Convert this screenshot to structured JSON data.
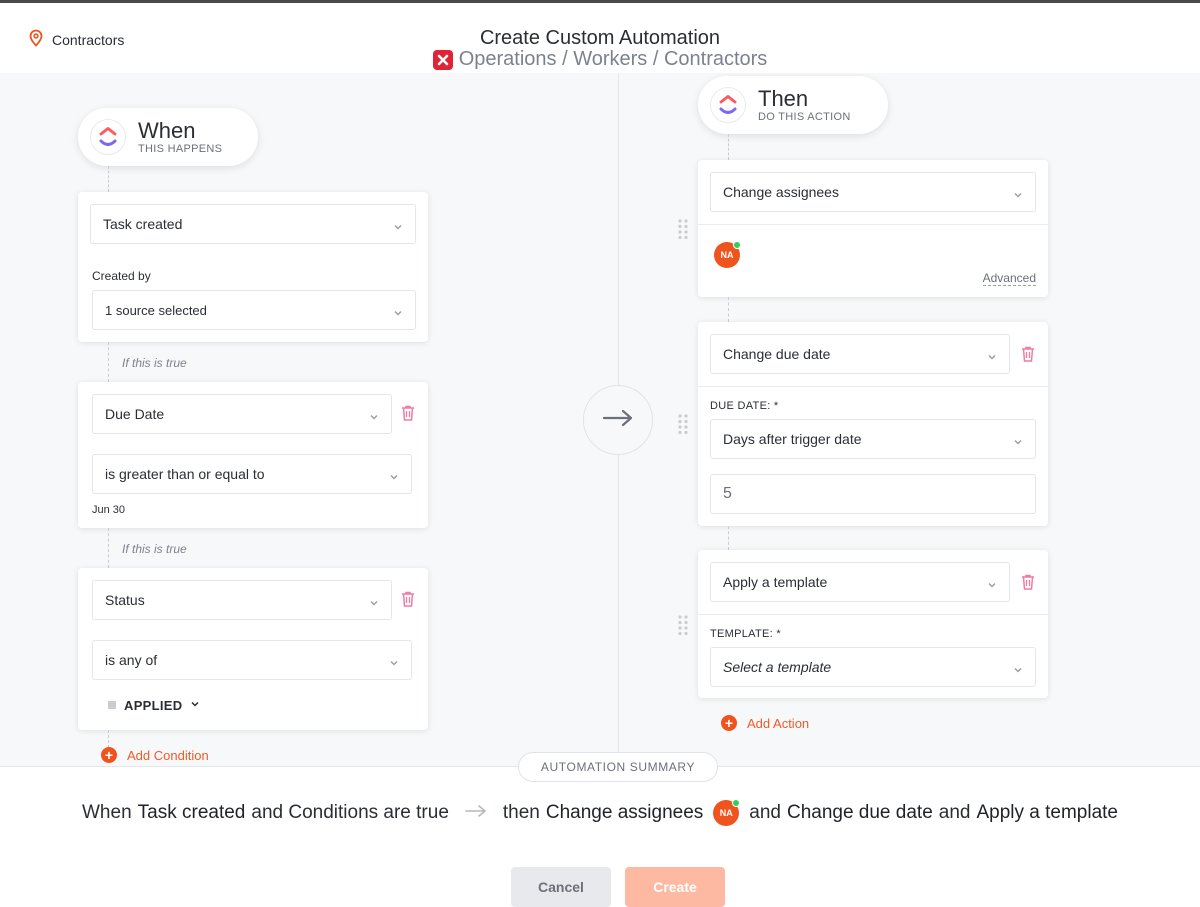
{
  "header": {
    "location_label": "Contractors",
    "title": "Create Custom Automation",
    "path": "Operations / Workers / Contractors"
  },
  "when": {
    "title": "When",
    "subtitle": "THIS HAPPENS",
    "trigger": {
      "select": "Task created",
      "created_by_label": "Created by",
      "source_select": "1 source selected"
    },
    "conditions": [
      {
        "connector": "If this is true",
        "field": "Due Date",
        "operator": "is greater than or equal to",
        "value": "Jun 30"
      },
      {
        "connector": "If this is true",
        "field": "Status",
        "operator": "is any of",
        "value": "APPLIED"
      }
    ],
    "add_condition": "Add Condition"
  },
  "then": {
    "title": "Then",
    "subtitle": "DO THIS ACTION",
    "actions": [
      {
        "select": "Change assignees",
        "assignee_initials": "NA",
        "advanced": "Advanced"
      },
      {
        "select": "Change due date",
        "field_label": "DUE DATE: *",
        "mode": "Days after trigger date",
        "days_value": "5"
      },
      {
        "select": "Apply a template",
        "field_label": "TEMPLATE: *",
        "placeholder": "Select a template"
      }
    ],
    "add_action": "Add Action"
  },
  "summary": {
    "badge": "AUTOMATION SUMMARY",
    "when": "When",
    "trigger": "Task created",
    "and1": "and Conditions are true",
    "then": "then",
    "action1": "Change assignees",
    "avatar": "NA",
    "and2": "and",
    "action2": "Change due date",
    "and3": "and",
    "action3": "Apply a template"
  },
  "buttons": {
    "cancel": "Cancel",
    "create": "Create"
  },
  "colors": {
    "accent": "#f0541e",
    "trash": "#f27aa3",
    "create_disabled": "#fdb9a2",
    "online": "#2fcf5b"
  }
}
